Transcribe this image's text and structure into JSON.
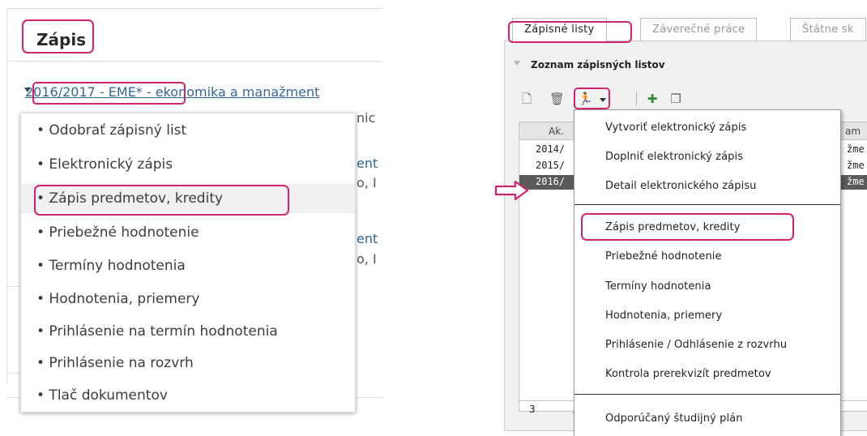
{
  "left": {
    "title": "Zápis",
    "tree_item": {
      "year_program": "2016/2017 - EME*",
      "separator": " - ",
      "program_name": "ekonomika a manažment"
    },
    "background_fragments": [
      "nic",
      "ent",
      "o, I",
      "ent",
      "o, I"
    ],
    "menu_items": [
      "• Odobrať zápisný list",
      "• Elektronický zápis",
      "• Zápis predmetov, kredity",
      "• Priebežné hodnotenie",
      "• Termíny hodnotenia",
      "• Hodnotenia, priemery",
      "• Prihlásenie na termín hodnotenia",
      "• Prihlásenie na rozvrh",
      "• Tlač dokumentov"
    ]
  },
  "right": {
    "tabs": [
      "Zápisné listy",
      "Záverečné práce",
      "Štátne sk"
    ],
    "section_title": "Zoznam zápisných listov",
    "toolbar_icons": [
      "new-document-icon",
      "trash-icon",
      "action-runner-icon",
      "add-icon",
      "copy-icon"
    ],
    "grid": {
      "header": "Ak.",
      "header_right": "am",
      "rows": [
        {
          "year": "2014/",
          "tail": "žme"
        },
        {
          "year": "2015/",
          "tail": "žme"
        },
        {
          "year": "2016/",
          "tail": "žme"
        }
      ],
      "footer_count": "3",
      "footer_sep": "/"
    },
    "dropdown": {
      "group1": [
        "Vytvoriť elektronický zápis",
        "Doplniť elektronický zápis",
        "Detail elektronického zápisu"
      ],
      "group2": [
        "Zápis predmetov, kredity",
        "Priebežné hodnotenie",
        "Termíny hodnotenia",
        "Hodnotenia, priemery",
        "Prihlásenie / Odhlásenie z rozvrhu",
        "Kontrola prerekvizít predmetov"
      ],
      "group3": [
        "Odporúčaný študijný plán"
      ]
    }
  },
  "colors": {
    "highlight": "#d1246f",
    "link": "#336699",
    "selected_row": "#5a5a5a"
  }
}
